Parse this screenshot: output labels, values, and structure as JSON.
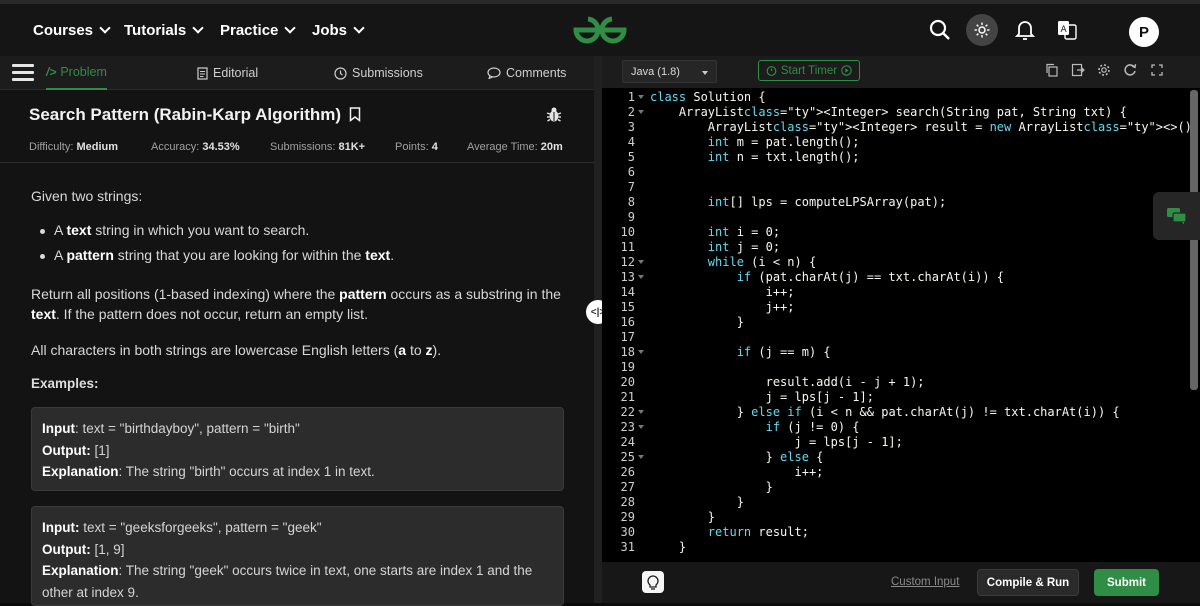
{
  "topnav": {
    "items": [
      "Courses",
      "Tutorials",
      "Practice",
      "Jobs"
    ],
    "icons": [
      "search-icon",
      "theme-toggle-icon",
      "bell-icon",
      "translate-icon"
    ],
    "avatar_initial": "P",
    "brand_color": "#2f8d46"
  },
  "tabs": [
    {
      "label": "Problem",
      "icon": "code-icon",
      "active": true
    },
    {
      "label": "Editorial",
      "icon": "document-icon",
      "active": false
    },
    {
      "label": "Submissions",
      "icon": "clock-icon",
      "active": false
    },
    {
      "label": "Comments",
      "icon": "comment-icon",
      "active": false
    }
  ],
  "problem": {
    "title": "Search Pattern (Rabin-Karp Algorithm)",
    "meta": {
      "difficulty_label": "Difficulty:",
      "difficulty": "Medium",
      "accuracy_label": "Accuracy:",
      "accuracy": "34.53%",
      "submissions_label": "Submissions:",
      "submissions": "81K+",
      "points_label": "Points:",
      "points": "4",
      "time_label": "Average Time:",
      "time": "20m"
    },
    "intro": "Given two strings:",
    "bullet1": {
      "pre": "A ",
      "bold": "text",
      "post": " string in which you want to search."
    },
    "bullet2": {
      "pre": "A ",
      "bold": "pattern",
      "post": " string that you are looking for within the ",
      "bold2": "text",
      "end": "."
    },
    "para1": {
      "a": "Return all positions (1-based indexing) where the ",
      "b": "pattern",
      "c": " occurs as a substring in the ",
      "d": "text",
      "e": ". If the pattern does not occur, return an empty list."
    },
    "para2": {
      "a": "All characters in both strings are lowercase English letters (",
      "b": "a",
      "c": " to ",
      "d": "z",
      "e": ")."
    },
    "examples_heading": "Examples:",
    "examples": [
      {
        "input_label": "Input",
        "input": ": text = \"birthdayboy\", pattern = \"birth\"",
        "output_label": "Output:",
        "output": " [1]",
        "expl_label": "Explanation",
        "expl": ": The string \"birth\" occurs at index 1 in text."
      },
      {
        "input_label": "Input:",
        "input": " text = \"geeksforgeeks\", pattern = \"geek\"",
        "output_label": "Output:",
        "output": " [1, 9]",
        "expl_label": "Explanation",
        "expl": ": The string \"geek\" occurs twice in text, one starts are index 1 and the other at index 9."
      }
    ]
  },
  "editor": {
    "language": "Java (1.8)",
    "timer_label": "Start Timer",
    "toolbar_icons": [
      "copy-icon",
      "import-icon",
      "settings-icon",
      "reset-icon",
      "fullscreen-icon"
    ],
    "code": [
      "class Solution {",
      "    ArrayList<Integer> search(String pat, String txt) {",
      "        ArrayList<Integer> result = new ArrayList<>();",
      "        int m = pat.length();",
      "        int n = txt.length();",
      "",
      "",
      "        int[] lps = computeLPSArray(pat);",
      "",
      "        int i = 0;",
      "        int j = 0;",
      "        while (i < n) {",
      "            if (pat.charAt(j) == txt.charAt(i)) {",
      "                i++;",
      "                j++;",
      "            }",
      "",
      "            if (j == m) {",
      "",
      "                result.add(i - j + 1);",
      "                j = lps[j - 1];",
      "            } else if (i < n && pat.charAt(j) != txt.charAt(i)) {",
      "                if (j != 0) {",
      "                    j = lps[j - 1];",
      "                } else {",
      "                    i++;",
      "                }",
      "            }",
      "        }",
      "        return result;",
      "    }"
    ],
    "fold_lines": [
      1,
      2,
      12,
      13,
      18,
      22,
      23,
      25
    ],
    "custom_input": "Custom Input",
    "compile_label": "Compile & Run",
    "submit_label": "Submit"
  }
}
